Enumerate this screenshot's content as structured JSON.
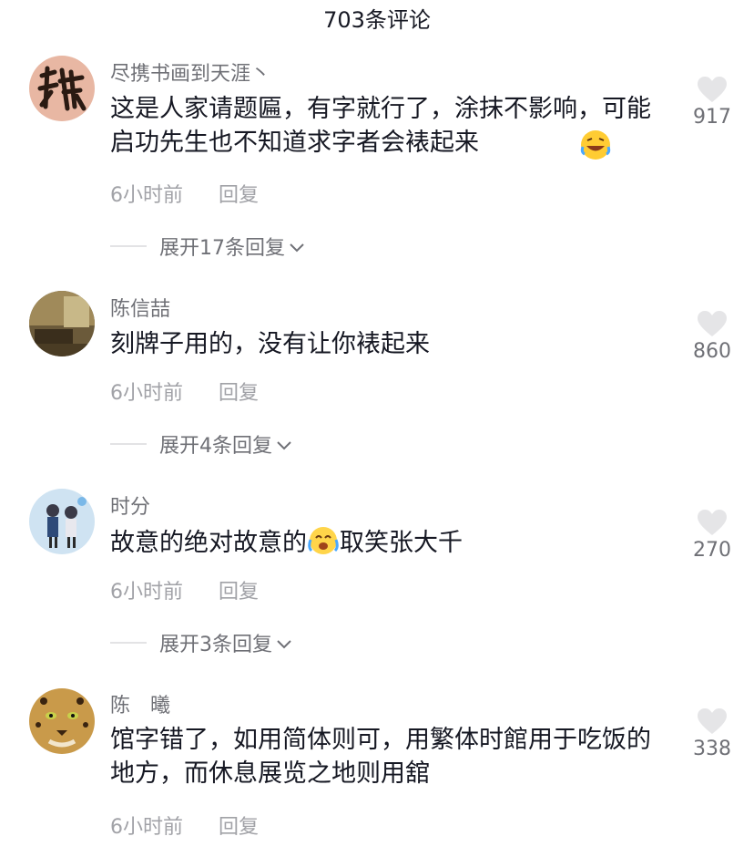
{
  "header": {
    "title": "703条评论"
  },
  "comments": [
    {
      "user": "尽携书画到天涯丶",
      "text": "这是人家请题匾，有字就行了，涂抹不影响，可能启功先生也不知道求字者会裱起来",
      "time": "6小时前",
      "reply": "回复",
      "likes": "917",
      "expand": "展开17条回复",
      "avatar_icon": "calligraphy-avatar"
    },
    {
      "user": "陈信喆",
      "text": "刻牌子用的，没有让你裱起来",
      "time": "6小时前",
      "reply": "回复",
      "likes": "860",
      "expand": "展开4条回复",
      "avatar_icon": "room-photo-avatar"
    },
    {
      "user": "时分",
      "text_before": "故意的绝对故意的",
      "text_after": "取笑张大千",
      "time": "6小时前",
      "reply": "回复",
      "likes": "270",
      "expand": "展开3条回复",
      "avatar_icon": "couple-illustration-avatar"
    },
    {
      "user": "陈　曦",
      "text": "馆字错了，如用简体则可，用繁体时館用于吃饭的地方，而休息展览之地则用舘",
      "time": "6小时前",
      "reply": "回复",
      "likes": "338",
      "avatar_icon": "leopard-avatar"
    }
  ],
  "colors": {
    "text_primary": "#161823",
    "text_secondary": "#6f7076",
    "text_tertiary": "#a1a2a7",
    "heart_gray": "#e5e5e7"
  }
}
